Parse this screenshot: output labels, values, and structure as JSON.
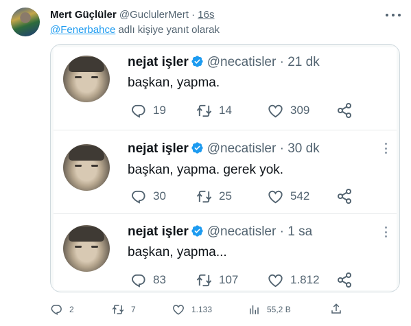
{
  "tweet": {
    "author_name": "Mert Güçlüler",
    "author_handle": "@GuclulerMert",
    "separator": "·",
    "time": "16s",
    "replying_mention": "@Fenerbahce",
    "replying_suffix": " adlı kişiye yanıt olarak",
    "actions": {
      "replies": "2",
      "retweets": "7",
      "likes": "1.133",
      "views": "55,2 B"
    }
  },
  "embedded_tweets": [
    {
      "name": "nejat işler",
      "handle": "@necatisler",
      "separator": "·",
      "time": "21 dk",
      "text": "başkan, yapma.",
      "replies": "19",
      "retweets": "14",
      "likes": "309"
    },
    {
      "name": "nejat işler",
      "handle": "@necatisler",
      "separator": "·",
      "time": "30 dk",
      "text": "başkan, yapma. gerek yok.",
      "replies": "30",
      "retweets": "25",
      "likes": "542"
    },
    {
      "name": "nejat işler",
      "handle": "@necatisler",
      "separator": "·",
      "time": "1 sa",
      "text": "başkan, yapma...",
      "replies": "83",
      "retweets": "107",
      "likes": "1.812"
    }
  ],
  "colors": {
    "text_primary": "#0f1419",
    "text_secondary": "#536471",
    "link": "#1d9bf0",
    "verified": "#1d9bf0",
    "border": "#cfd9de"
  },
  "icons": {
    "reply": "reply-icon",
    "retweet": "retweet-icon",
    "like": "heart-icon",
    "views": "views-icon",
    "share": "share-icon",
    "embedded_share": "share-nodes-icon",
    "verified": "verified-badge-icon",
    "more": "more-icon"
  }
}
